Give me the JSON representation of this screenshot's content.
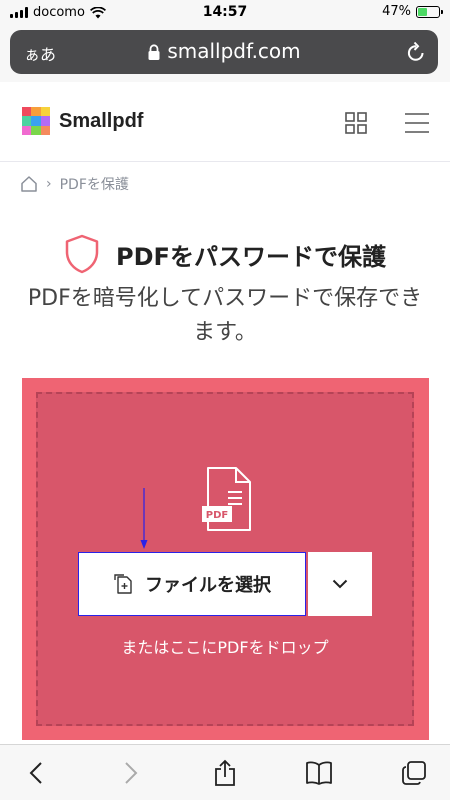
{
  "status_bar": {
    "carrier": "docomo",
    "time": "14:57",
    "battery": "47%",
    "battery_level": 0.47
  },
  "address_bar": {
    "text_size_label": "ぁあ",
    "url": "smallpdf.com"
  },
  "header": {
    "brand": "Smallpdf",
    "logo_colors": [
      "#ef4a5d",
      "#f79e3b",
      "#f7d23b",
      "#4bd3a1",
      "#3aa1f0",
      "#b36bf5",
      "#f06bd0",
      "#7bd64b",
      "#f58a5d"
    ]
  },
  "breadcrumb": {
    "separator": "›",
    "current": "PDFを保護"
  },
  "main": {
    "title": "PDFをパスワードで保護",
    "subtitle": "PDFを暗号化してパスワードで保存できます。",
    "choose_label": "ファイルを選択",
    "drop_text": "またはここにPDFをドロップ",
    "pdf_icon_label": "PDF"
  },
  "colors": {
    "accent": "#ef6473",
    "dropzone_inner": "#d8566a",
    "annotation": "#2a22e8"
  }
}
